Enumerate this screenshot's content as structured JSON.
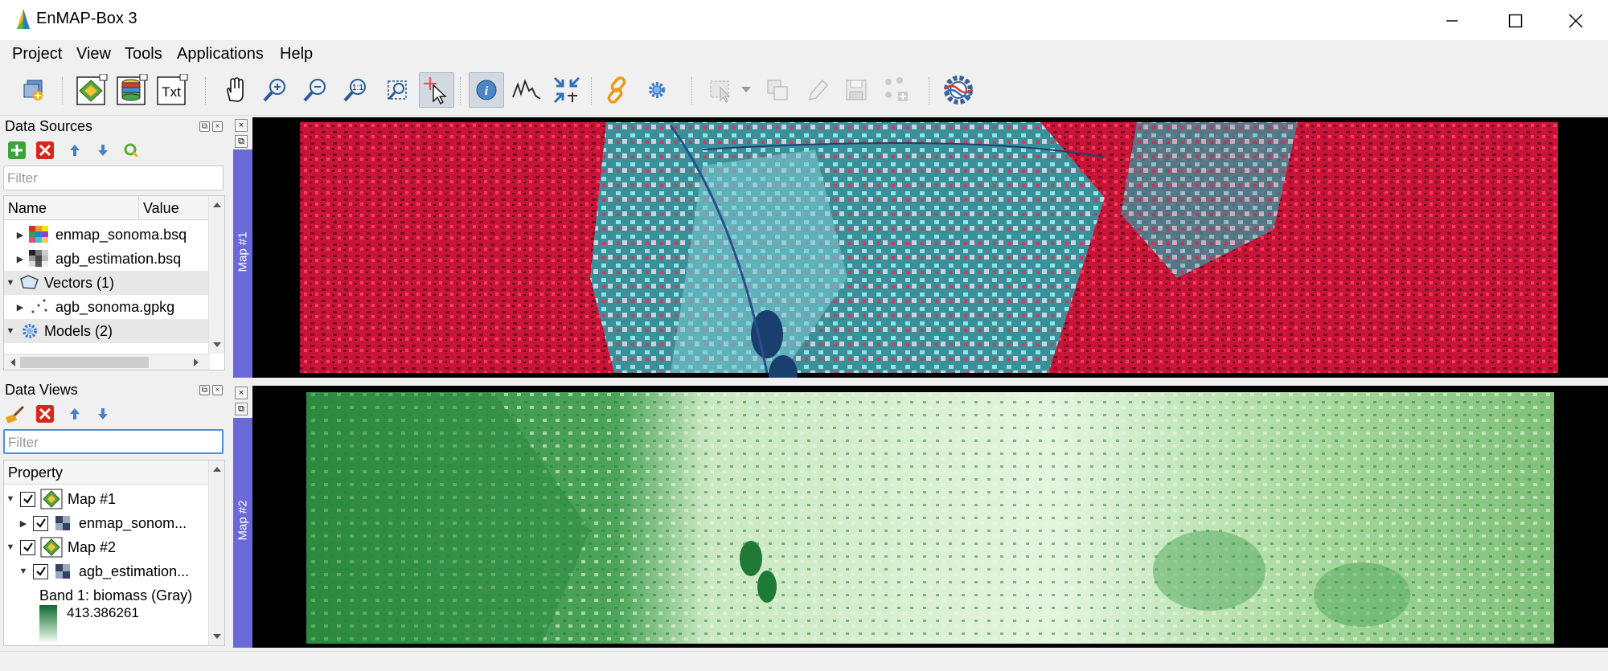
{
  "window": {
    "title": "EnMAP-Box 3",
    "minimize_label": "minimize",
    "maximize_label": "maximize",
    "close_label": "close"
  },
  "menu": [
    "Project",
    "View",
    "Tools",
    "Applications",
    "Help"
  ],
  "toolbar": {
    "icons": [
      "add-data-source-icon",
      "open-map-view-icon",
      "open-spectral-library-icon",
      "open-text-view-icon",
      "pan-icon",
      "zoom-in-icon",
      "zoom-out-icon",
      "zoom-native-resolution-icon",
      "zoom-full-extent-icon",
      "select-location-icon",
      "identify-icon",
      "spectral-profile-icon",
      "crosshair-sync-icon",
      "link-maps-icon",
      "settings-icon",
      "select-features-icon",
      "copy-features-icon",
      "edit-features-icon",
      "save-edits-icon",
      "add-feature-icon",
      "processing-toolbox-icon"
    ],
    "txt_label": "Txt"
  },
  "data_sources": {
    "title": "Data Sources",
    "filter_placeholder": "Filter",
    "columns": [
      "Name",
      "Value"
    ],
    "rows": [
      {
        "label": "enmap_sonoma.bsq"
      },
      {
        "label": "agb_estimation.bsq"
      },
      {
        "label": "Vectors (1)"
      },
      {
        "label": "agb_sonoma.gpkg"
      },
      {
        "label": "Models (2)"
      }
    ]
  },
  "data_views": {
    "title": "Data Views",
    "filter_placeholder": "Filter",
    "columns": [
      "Property"
    ],
    "rows": [
      {
        "label": "Map #1"
      },
      {
        "label": "enmap_sonom..."
      },
      {
        "label": "Map #2"
      },
      {
        "label": "agb_estimation..."
      },
      {
        "label": "Band 1: biomass (Gray)"
      },
      {
        "label": "413.386261"
      }
    ]
  },
  "maps": [
    {
      "label": "Map #1"
    },
    {
      "label": "Map #2"
    }
  ],
  "colors": {
    "map_dock_side": "#6a6ad6",
    "accent_focus": "#4a90d9",
    "biomass_dark": "#0b6b2b",
    "biomass_light": "#f2fbef",
    "false_color_red": "#d0163b",
    "false_color_cyan": "#48d2cf"
  }
}
